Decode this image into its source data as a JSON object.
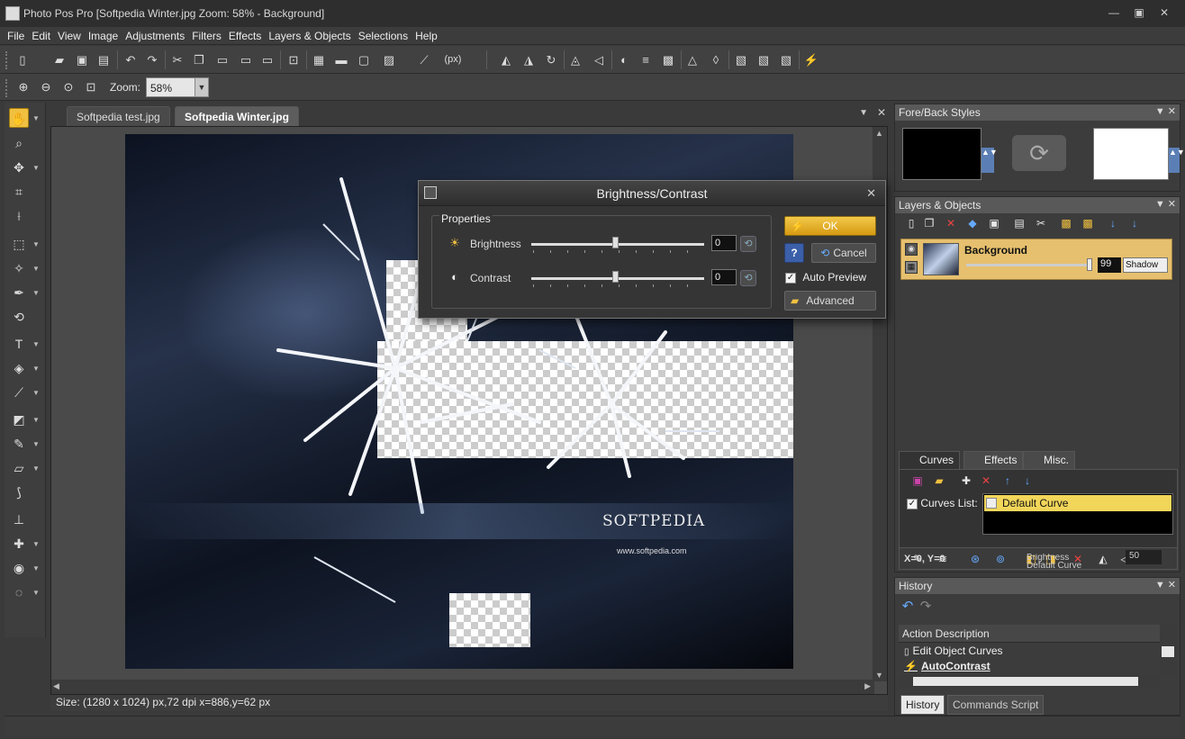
{
  "window": {
    "title": "Photo Pos Pro [Softpedia Winter.jpg Zoom: 58% - Background]",
    "min_icon": "minimize-icon",
    "max_icon": "maximize-icon",
    "close_icon": "close-icon"
  },
  "menu": [
    "File",
    "Edit",
    "View",
    "Image",
    "Adjustments",
    "Filters",
    "Effects",
    "Layers & Objects",
    "Selections",
    "Help"
  ],
  "toolbar": {
    "units_label": "(px)",
    "zoom_label": "Zoom:",
    "zoom_value": "58%"
  },
  "doc_tabs": [
    {
      "label": "Softpedia test.jpg",
      "active": false
    },
    {
      "label": "Softpedia Winter.jpg",
      "active": true
    }
  ],
  "image": {
    "brand_text": "SOFTPEDIA",
    "url_text": "www.softpedia.com"
  },
  "statusbar": {
    "text": "Size: (1280 x 1024) px,72 dpi   x=886,y=62 px"
  },
  "dialog": {
    "title": "Brightness/Contrast",
    "group_label": "Properties",
    "brightness_label": "Brightness",
    "brightness_value": "0",
    "contrast_label": "Contrast",
    "contrast_value": "0",
    "ok_label": "OK",
    "help_label": "?",
    "cancel_label": "Cancel",
    "auto_preview_label": "Auto Preview",
    "auto_preview_checked": true,
    "advanced_label": "Advanced"
  },
  "panels": {
    "fore_back": {
      "title": "Fore/Back Styles",
      "fore_color": "#000000",
      "back_color": "#ffffff"
    },
    "layers": {
      "title": "Layers & Objects",
      "layer_name": "Background",
      "opacity": "99",
      "blend": "Shadow"
    },
    "curves_tabs": [
      "Curves",
      "Effects",
      "Misc."
    ],
    "curves": {
      "list_label": "Curves List:",
      "list_checked": true,
      "selected_item": "Default Curve",
      "coords": "X=0, Y=0",
      "bottom_label1": "Brightness",
      "bottom_label2": "Default Curve",
      "bottom_value": "50"
    },
    "history": {
      "title": "History",
      "column": "Action Description",
      "rows": [
        "Edit Object Curves",
        "AutoContrast"
      ],
      "tabs": [
        "History",
        "Commands Script"
      ]
    }
  },
  "colors": {
    "accent": "#f0c040",
    "selected_layer": "#e6c06e",
    "panel_header": "#595959"
  }
}
